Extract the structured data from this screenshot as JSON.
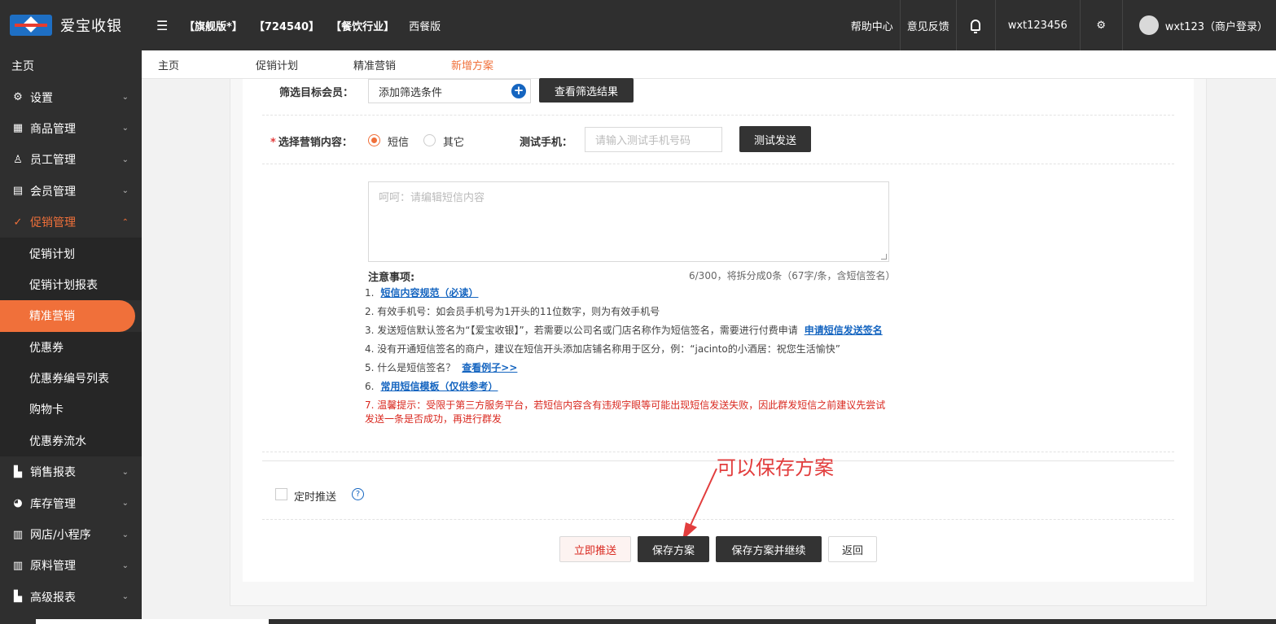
{
  "header": {
    "logo_text": "爱宝收银",
    "tags": [
      "【旗舰版*】",
      "【724540】",
      "【餐饮行业】",
      "西餐版"
    ],
    "help": "帮助中心",
    "feedback": "意见反馈",
    "account": "wxt123456",
    "user": "wxt123（商户登录）"
  },
  "sidebar": {
    "home": "主页",
    "items": [
      {
        "label": "设置",
        "icon": "gear-icon",
        "glyph": "⚙"
      },
      {
        "label": "商品管理",
        "icon": "goods-icon",
        "glyph": "▦"
      },
      {
        "label": "员工管理",
        "icon": "staff-icon",
        "glyph": "♙"
      },
      {
        "label": "会员管理",
        "icon": "member-icon",
        "glyph": "▤"
      },
      {
        "label": "促销管理",
        "icon": "promotion-icon",
        "glyph": "✓"
      }
    ],
    "subitems": [
      "促销计划",
      "促销计划报表",
      "精准营销",
      "优惠券",
      "优惠券编号列表",
      "购物卡",
      "优惠券流水"
    ],
    "items_after": [
      {
        "label": "销售报表",
        "icon": "chart-icon",
        "glyph": "▙"
      },
      {
        "label": "库存管理",
        "icon": "pie-icon",
        "glyph": "◕"
      },
      {
        "label": "网店/小程序",
        "icon": "shop-icon",
        "glyph": "▥"
      },
      {
        "label": "原料管理",
        "icon": "material-icon",
        "glyph": "▥"
      },
      {
        "label": "高级报表",
        "icon": "report-icon",
        "glyph": "▙"
      }
    ]
  },
  "tabs": [
    "主页",
    "促销计划",
    "精准营销",
    "新增方案"
  ],
  "form": {
    "filter_label": "筛选目标会员：",
    "filter_value": "添加筛选条件",
    "view_result": "查看筛选结果",
    "content_label": "选择营销内容：",
    "opt_sms": "短信",
    "opt_other": "其它",
    "test_phone_label": "测试手机：",
    "test_phone_placeholder": "请输入测试手机号码",
    "test_send": "测试发送",
    "sms_placeholder": "呵呵：请编辑短信内容",
    "notes_title": "注意事项:",
    "counter": "6/300，将拆分成0条（67字/条，含短信签名）",
    "notes": [
      {
        "num": "1.",
        "text": "",
        "link": "短信内容规范（必读）"
      },
      {
        "num": "2.",
        "text": "有效手机号：如会员手机号为1开头的11位数字，则为有效手机号",
        "link": ""
      },
      {
        "num": "3.",
        "text": "发送短信默认签名为“【爱宝收银】”，若需要以公司名或门店名称作为短信签名，需要进行付费申请",
        "link": "申请短信发送签名"
      },
      {
        "num": "4.",
        "text": "没有开通短信签名的商户，建议在短信开头添加店铺名称用于区分，例：“jacinto的小酒居：祝您生活愉快”",
        "link": ""
      },
      {
        "num": "5.",
        "text": "什么是短信签名？",
        "link": "查看例子>>"
      },
      {
        "num": "6.",
        "text": "",
        "link": "常用短信模板（仅供参考）"
      },
      {
        "num": "7.",
        "text": "温馨提示：受限于第三方服务平台，若短信内容含有违规字眼等可能出现短信发送失败，因此群发短信之前建议先尝试发送一条是否成功，再进行群发",
        "link": ""
      }
    ],
    "schedule": "定时推送",
    "btn_push": "立即推送",
    "btn_save": "保存方案",
    "btn_save_continue": "保存方案并继续",
    "btn_back": "返回"
  },
  "annotation": "可以保存方案",
  "colors": {
    "accent": "#f0703a",
    "dark": "#2f2f2f",
    "link": "#1565c0",
    "warn": "#d9281f"
  }
}
